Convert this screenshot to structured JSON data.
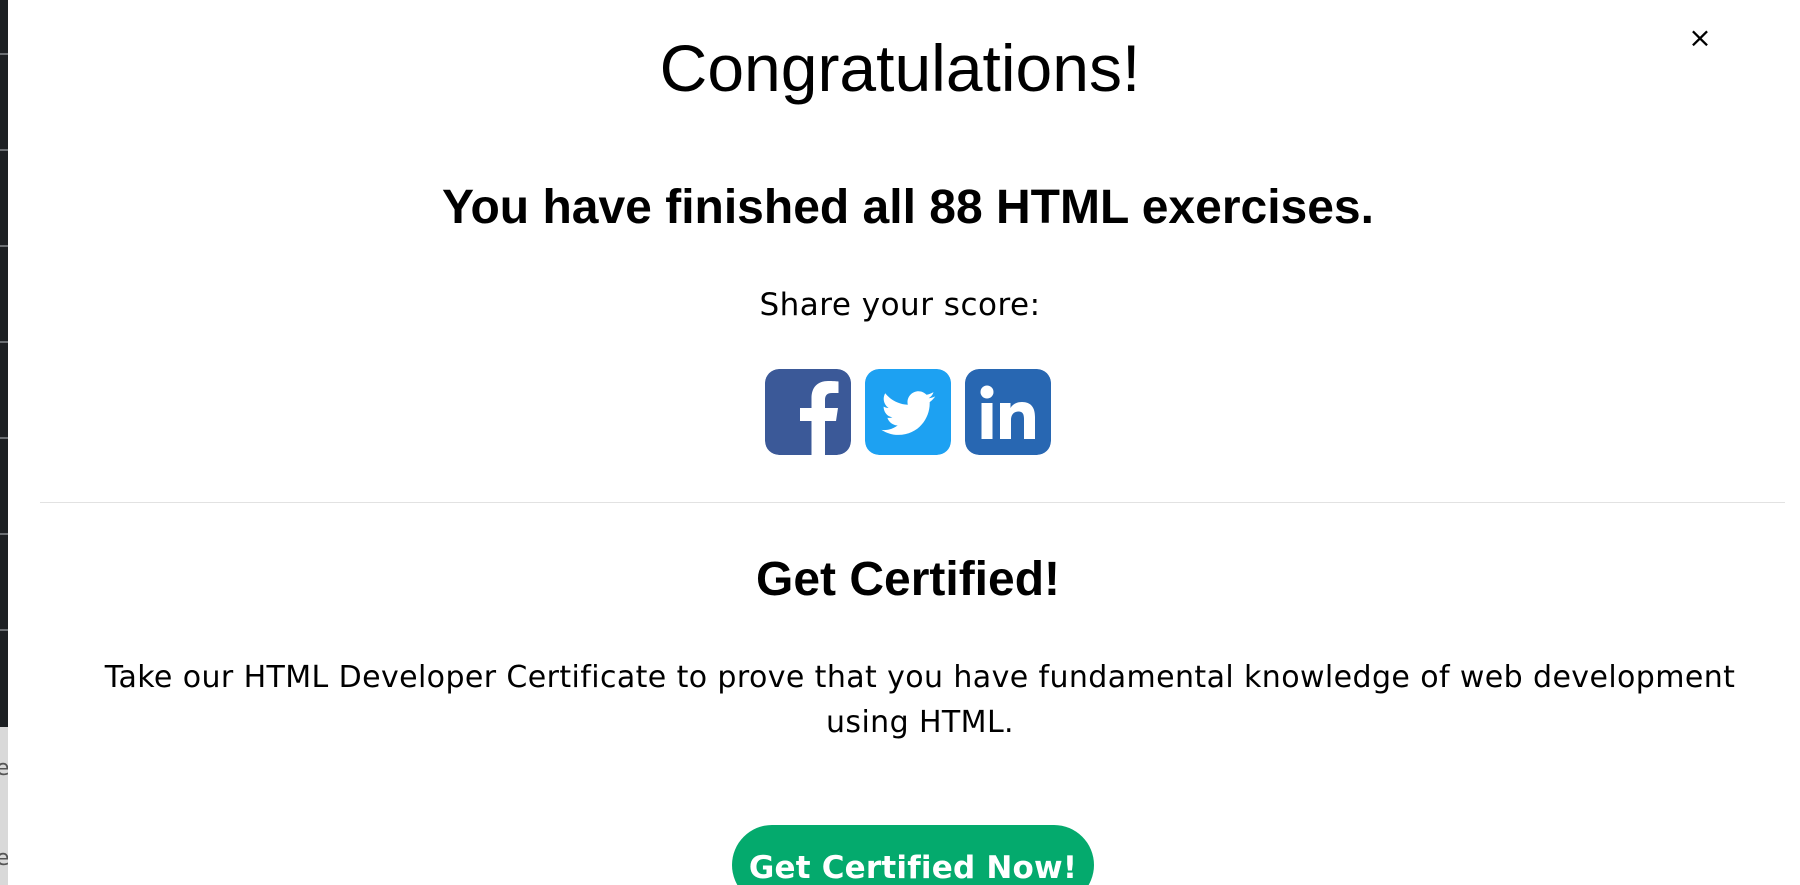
{
  "modal": {
    "close_symbol": "×",
    "title": "Congratulations!",
    "subtitle": "You have finished all 88 HTML exercises.",
    "share_label": "Share your score:",
    "social": [
      {
        "icon": "facebook-icon",
        "color": "#3b5998"
      },
      {
        "icon": "twitter-icon",
        "color": "#1da1f2"
      },
      {
        "icon": "linkedin-icon",
        "color": "#2867b2"
      }
    ],
    "cert_title": "Get Certified!",
    "cert_text": "Take our HTML Developer Certificate to prove that you have fundamental knowledge of web development using HTML.",
    "cta_label": "Get Certified Now!",
    "cta_color": "#04aa6d"
  },
  "background": {
    "edge_glyph": "e"
  }
}
